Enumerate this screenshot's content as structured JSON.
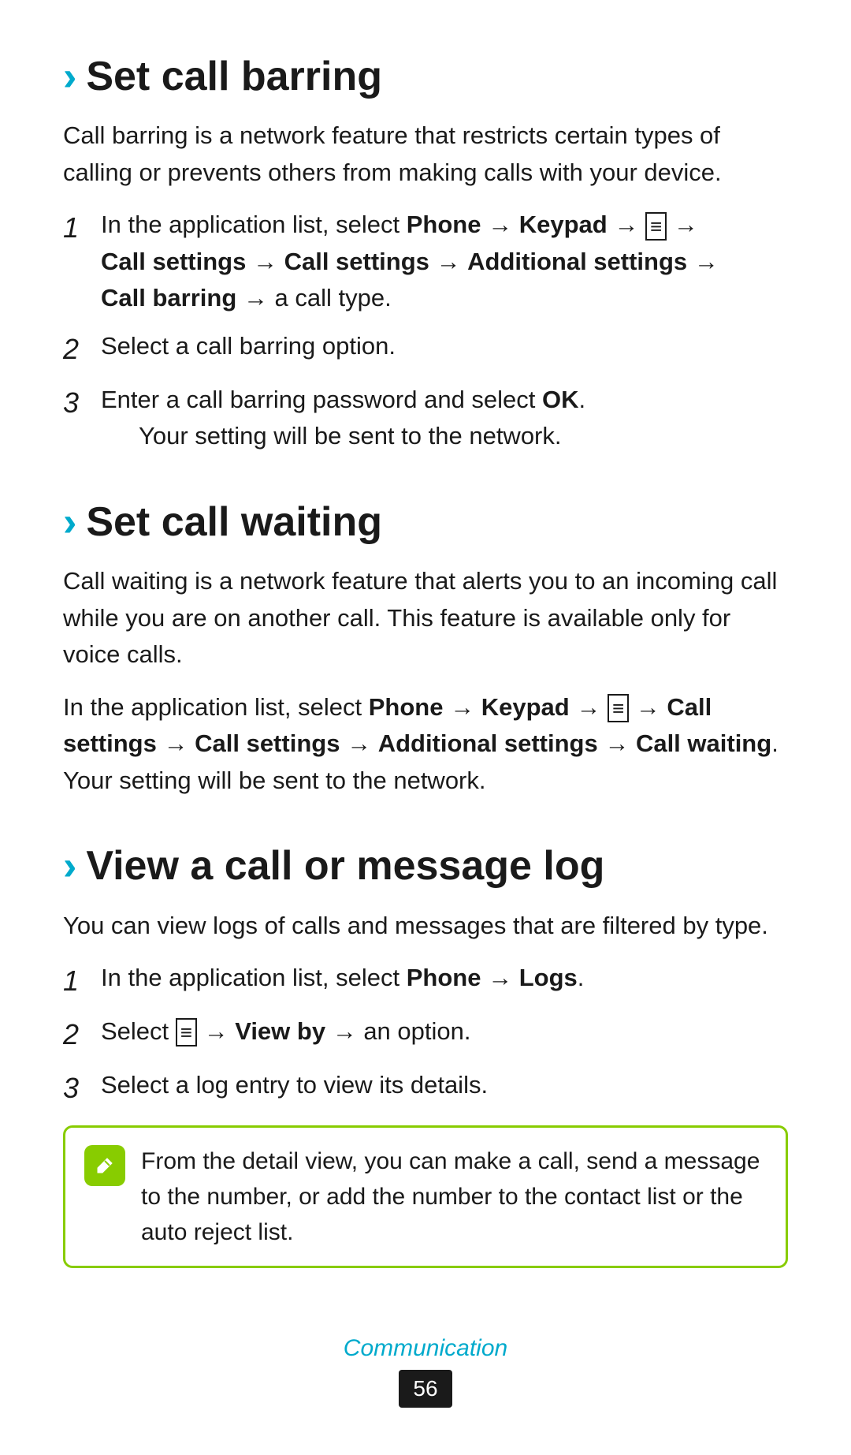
{
  "sections": [
    {
      "id": "call-barring",
      "title": "Set call barring",
      "description": "Call barring is a network feature that restricts certain types of calling or prevents others from making calls with your device.",
      "steps": [
        {
          "num": "1",
          "html_content": "In the application list, select <b>Phone</b> → <b>Keypad</b> → <span class='menu-icon-placeholder'></span> → <b>Call settings</b> → <b>Call settings</b> → <b>Additional settings</b> → <b>Call barring</b> → a call type."
        },
        {
          "num": "2",
          "html_content": "Select a call barring option."
        },
        {
          "num": "3",
          "html_content": "Enter a call barring password and select <b>OK</b>.",
          "sub": "Your setting will be sent to the network."
        }
      ]
    },
    {
      "id": "call-waiting",
      "title": "Set call waiting",
      "description": "Call waiting is a network feature that alerts you to an incoming call while you are on another call. This feature is available only for voice calls.",
      "inline_para": "In the application list, select <b>Phone</b> → <b>Keypad</b> → <span class='menu-icon-placeholder'></span> → <b>Call settings</b> → <b>Call settings</b> → <b>Additional settings</b> → <b>Call waiting</b>. Your setting will be sent to the network."
    },
    {
      "id": "view-log",
      "title": "View a call or message log",
      "description": "You can view logs of calls and messages that are filtered by type.",
      "steps": [
        {
          "num": "1",
          "html_content": "In the application list, select <b>Phone</b> → <b>Logs</b>."
        },
        {
          "num": "2",
          "html_content": "Select <span class='menu-icon-placeholder'></span> → <b>View by</b> → an option."
        },
        {
          "num": "3",
          "html_content": "Select a log entry to view its details."
        }
      ],
      "note": "From the detail view, you can make a call, send a message to the number, or add the number to the contact list or the auto reject list."
    }
  ],
  "footer": {
    "label": "Communication",
    "page": "56"
  },
  "chevron_symbol": "›",
  "arrow_symbol": "→"
}
